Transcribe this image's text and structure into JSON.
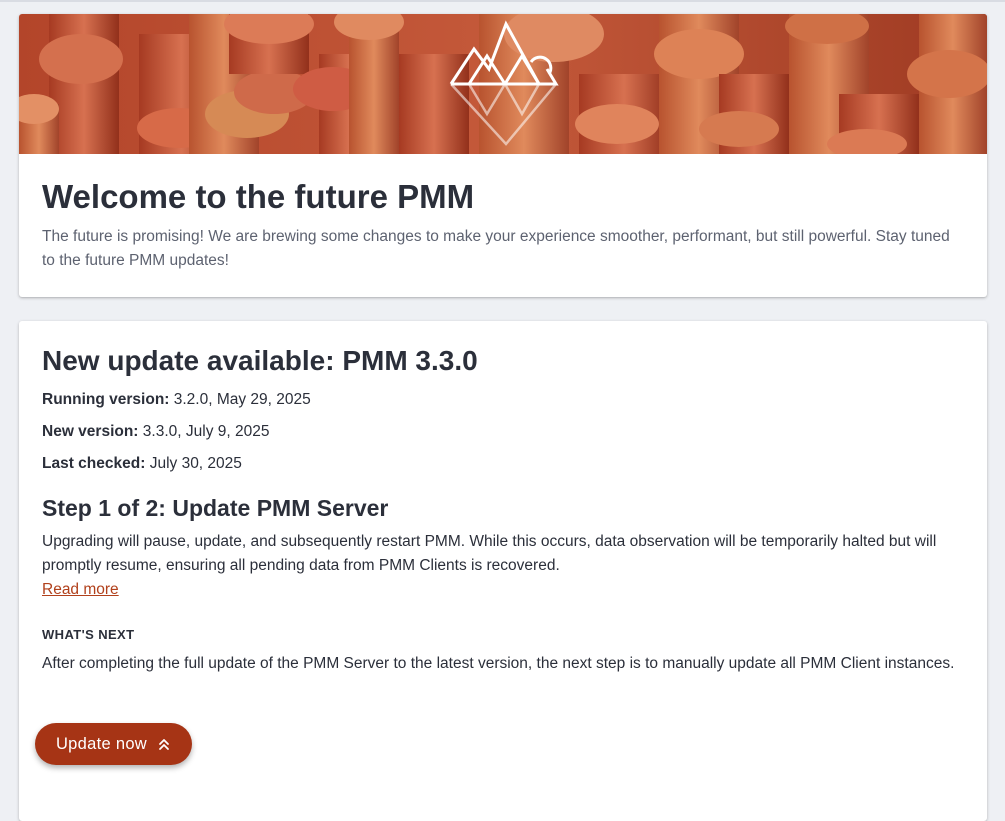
{
  "welcome": {
    "title": "Welcome to the future PMM",
    "description": "The future is promising! We are brewing some changes to make your experience smoother, performant, but still powerful. Stay tuned to the future PMM updates!"
  },
  "update": {
    "title": "New update available: PMM 3.3.0",
    "running_label": "Running version:",
    "running_value": " 3.2.0, May 29, 2025",
    "new_label": "New version:",
    "new_value": " 3.3.0, July 9, 2025",
    "checked_label": "Last checked:",
    "checked_value": " July 30, 2025",
    "step_title": "Step 1 of 2: Update PMM Server",
    "step_text": "Upgrading will pause, update, and subsequently restart PMM. While this occurs, data observation will be temporarily halted but will promptly resume, ensuring all pending data from PMM Clients is recovered.",
    "read_more": "Read more",
    "whats_next_label": "WHAT'S NEXT",
    "whats_next_text": "After completing the full update of the PMM Server to the latest version, the next step is to manually update all PMM Client instances.",
    "button_label": "Update now",
    "button_icon": "double-chevron-up-icon"
  },
  "colors": {
    "accent": "#a63415",
    "link": "#b1401b",
    "background": "#eef0f4",
    "text": "#2b2f3a"
  }
}
